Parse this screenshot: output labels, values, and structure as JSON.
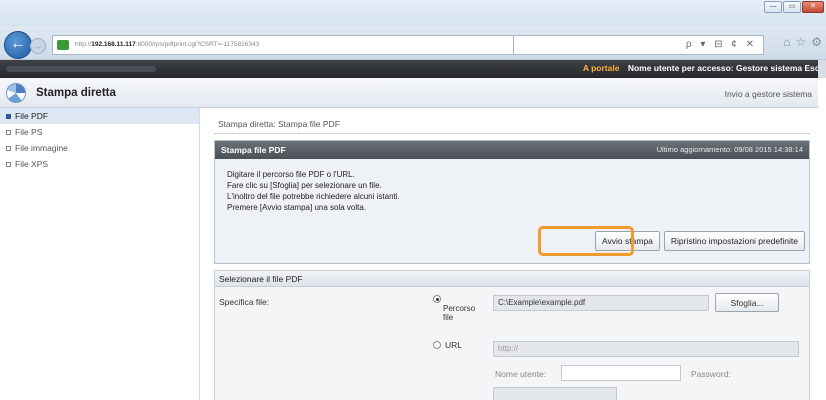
{
  "browser": {
    "url_prefix": "http://",
    "url_host": "192.168.11.117",
    "url_path": ":8000/rps/pdfprint.cgi?CSRT=-1175816343",
    "search_icons": "ρ ▾ ⊟ ¢ ✕",
    "window_controls": [
      "—",
      "▭",
      "✕"
    ]
  },
  "topbar": {
    "portal_link": "A portale",
    "user_info": "Nome utente per accesso: Gestore sistema Esci"
  },
  "header": {
    "title": "Stampa diretta",
    "link": "Invio a gestore sistema"
  },
  "sidebar": {
    "items": [
      {
        "label": "File PDF",
        "active": true
      },
      {
        "label": "File PS",
        "active": false
      },
      {
        "label": "File immagine",
        "active": false
      },
      {
        "label": "File XPS",
        "active": false
      }
    ]
  },
  "main": {
    "breadcrumb": "Stampa diretta: Stampa file PDF",
    "panel": {
      "title": "Stampa file PDF",
      "updated": "Ultimo aggiornamento: 09/08 2015 14:38:14",
      "instructions": [
        "Digitare il percorso file PDF o l'URL.",
        "Fare clic su [Sfoglia] per selezionare un file.",
        "L'inoltro del file potrebbe richiedere alcuni istanti.",
        "Premere [Avvio stampa] una sola volta."
      ],
      "start_button": "Avvio stampa",
      "reset_button": "Ripristino impostazioni predefinite"
    },
    "select_section": {
      "title": "Selezionare il file PDF",
      "spec_label": "Specifica file:",
      "option_path": "Percorso file",
      "path_value": "C:\\Example\\example.pdf",
      "browse_button": "Sfoglia...",
      "option_url": "URL",
      "url_value": "http://",
      "username_label": "Nome utente:",
      "password_label": "Password:"
    }
  }
}
